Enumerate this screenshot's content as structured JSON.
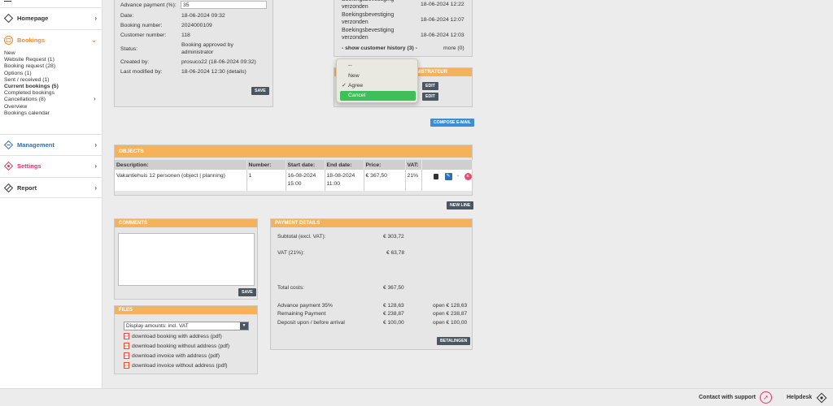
{
  "sidebar": {
    "items": [
      {
        "label": "Homepage"
      },
      {
        "label": "Bookings"
      },
      {
        "label": "Management"
      },
      {
        "label": "Settings"
      },
      {
        "label": "Report"
      }
    ],
    "bookings_sub": [
      "New",
      "Website Request (1)",
      "Booking request (28)",
      "Options (1)",
      "Sent / received (1)",
      "Current bookings (5)",
      "Completed bookings",
      "Cancellations (8)",
      "Overview",
      "Bookings calendar"
    ]
  },
  "booking": {
    "advance_label": "Advance payment (%):",
    "advance_value": "35",
    "rows": [
      {
        "label": "Date:",
        "value": "18-06-2024 09:32"
      },
      {
        "label": "Booking number:",
        "value": "2024000109"
      },
      {
        "label": "Customer number:",
        "value": "118"
      },
      {
        "label": "Status:",
        "value": "Booking approved by administrator"
      },
      {
        "label": "Created by:",
        "value": "prosuco22 (18-06-2024 09:32)"
      },
      {
        "label": "Last modified by:",
        "value": "18-06-2024 12:30 (details)"
      }
    ],
    "save": "SAVE"
  },
  "history": {
    "rows": [
      {
        "text": "Boekingsbevestiging verzonden",
        "date": "18-06-2024 12:22",
        "partial": true
      },
      {
        "text": "Boekingsbevestiging verzonden",
        "date": "18-06-2024 12:07"
      },
      {
        "text": "Boekingsbevestiging verzonden",
        "date": "18-06-2024 12:03"
      }
    ],
    "show_more": "- show customer history (3) -",
    "more": "more (0)"
  },
  "admin": {
    "header_suffix": "INISTRATEUR",
    "edit": "EDIT",
    "dropdown": [
      "--",
      "New",
      "Agree",
      "Cancel"
    ]
  },
  "compose": "COMPOSE E-MAIL",
  "objects": {
    "title": "OBJECTS",
    "headers": [
      "Description:",
      "Number:",
      "Start date:",
      "End date:",
      "Price:",
      "VAT:"
    ],
    "row": {
      "description": "Vakantiehuis 12 personen (object | planning)",
      "number": "1",
      "start": "16-08-2024",
      "start_time": "15:00",
      "end": "18-08-2024",
      "end_time": "11:00",
      "price": "€ 367,50",
      "vat": "21%"
    },
    "new_line": "NEW LINE"
  },
  "comments": {
    "title": "COMMENTS",
    "save": "SAVE"
  },
  "files": {
    "title": "FILES",
    "select": "Display amounts: incl. VAT",
    "links": [
      "download booking with address (pdf)",
      "download booking without address (pdf)",
      "download invoice with address (pdf)",
      "download invoice without address (pdf)"
    ]
  },
  "payment": {
    "title": "PAYMENT DETAILS",
    "subtotal_label": "Subtotal (excl. VAT):",
    "subtotal": "€ 303,72",
    "vat_label": "VAT (21%):",
    "vat": "€ 63,78",
    "total_label": "Total costs:",
    "total": "€ 367,50",
    "lines": [
      {
        "label": "Advance payment 35%",
        "amount": "€ 128,63",
        "open": "open € 128,63"
      },
      {
        "label": "Remaining Payment",
        "amount": "€ 238,87",
        "open": "open € 238,87"
      },
      {
        "label": "Deposit upon / before arrival",
        "amount": "€ 100,00",
        "open": "open € 100,00"
      }
    ],
    "button": "BETALINGEN"
  },
  "footer": {
    "support": "Contact with support",
    "helpdesk": "Helpdesk"
  },
  "colors": {
    "accent": "#f5b25a",
    "bookings": "#f08c2a",
    "settings": "#e0336a",
    "nav": "#2c6fb3",
    "green": "#3fbf5a",
    "blue_btn": "#3b8fd8"
  }
}
